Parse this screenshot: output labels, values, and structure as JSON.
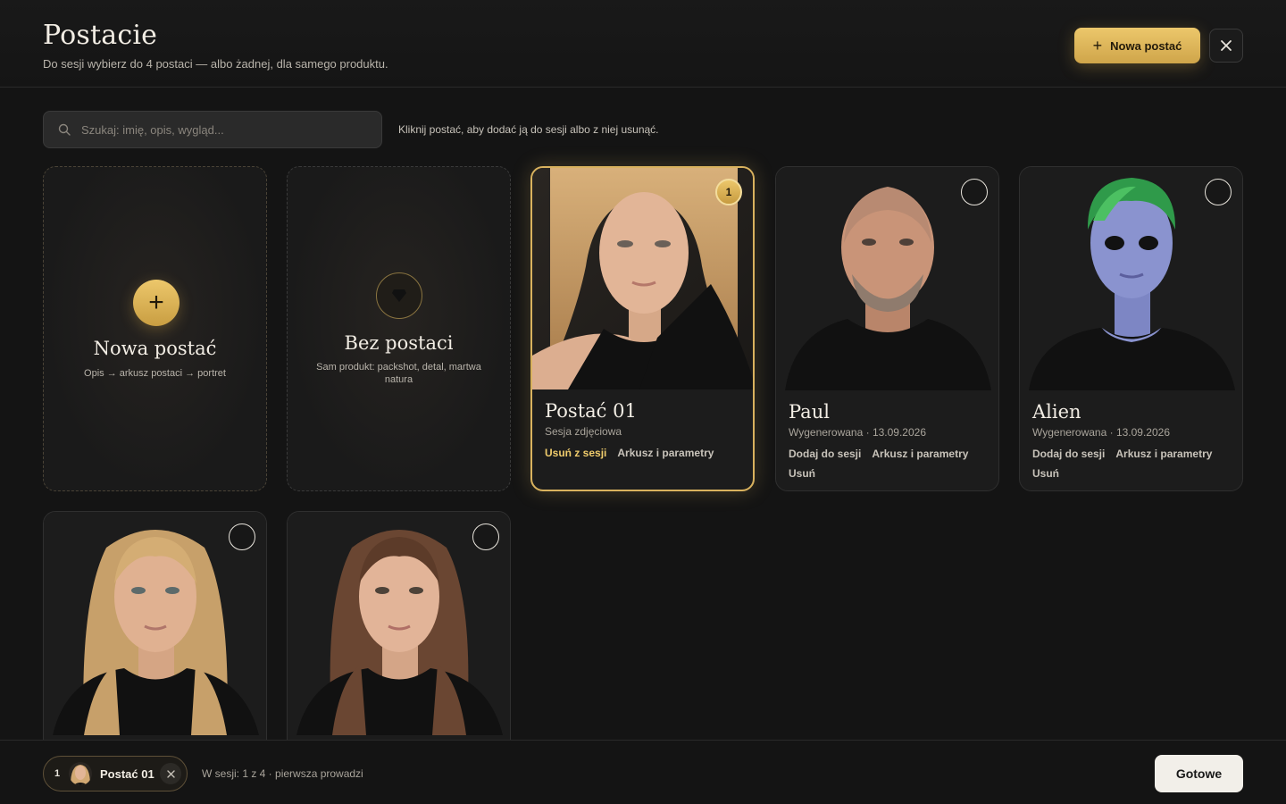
{
  "header": {
    "title": "Postacie",
    "subtitle": "Do sesji wybierz do 4 postaci — albo żadnej, dla samego produktu.",
    "new_button_label": "Nowa postać",
    "close_icon": "close-icon"
  },
  "search": {
    "placeholder": "Szukaj: imię, opis, wygląd...",
    "value": ""
  },
  "hint": "Kliknij postać, aby dodać ją do sesji albo z niej usunąć.",
  "cards": {
    "new": {
      "title": "Nowa postać",
      "description": "Opis → arkusz postaci → portret"
    },
    "none": {
      "title": "Bez postaci",
      "description": "Sam produkt: packshot, detal, martwa natura"
    },
    "items": [
      {
        "name": "Postać 01",
        "subtitle": "Sesja zdjęciowa",
        "selected": true,
        "order": "1",
        "actions": [
          "Usuń z sesji",
          "Arkusz i parametry"
        ]
      },
      {
        "name": "Paul",
        "subtitle": "Wygenerowana · 13.09.2026",
        "selected": false,
        "actions": [
          "Dodaj do sesji",
          "Arkusz i parametry",
          "Usuń"
        ]
      },
      {
        "name": "Alien",
        "subtitle": "Wygenerowana · 13.09.2026",
        "selected": false,
        "actions": [
          "Dodaj do sesji",
          "Arkusz i parametry",
          "Usuń"
        ]
      }
    ]
  },
  "footer": {
    "chip": {
      "order": "1",
      "name": "Postać 01"
    },
    "status": "W sesji: 1 z 4 · pierwsza prowadzi",
    "done_label": "Gotowe"
  },
  "colors": {
    "accent_gold": "#d9b25e",
    "background": "#141414",
    "card": "#1c1c1c"
  }
}
